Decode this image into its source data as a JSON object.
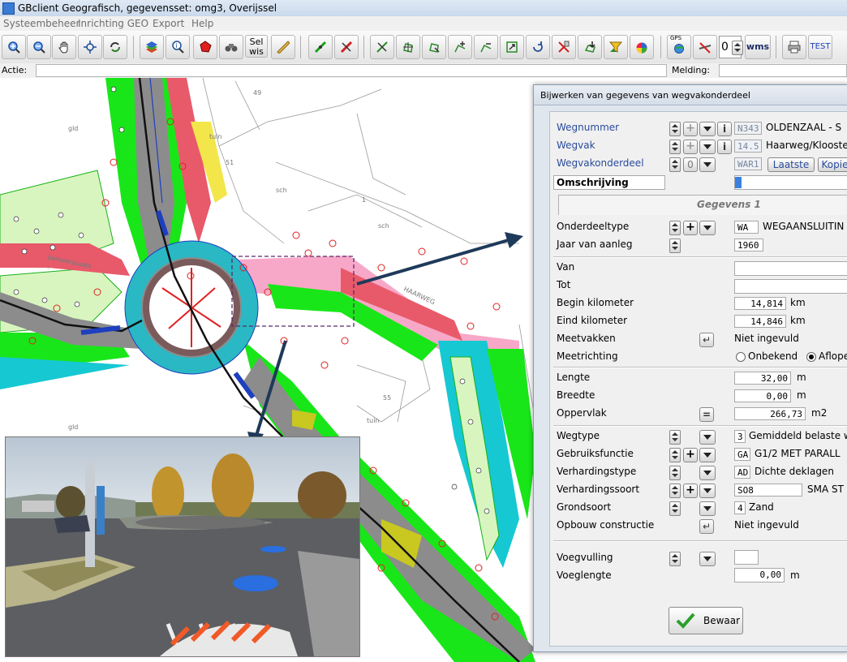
{
  "window": {
    "title": "GBclient Geografisch, gegevensset: omg3, Overijssel"
  },
  "menu": [
    "Systeembeheer",
    "Inrichting GEO",
    "Export",
    "Help"
  ],
  "toolbar": {
    "select_label": "Sel wis",
    "gps_label": "GPS",
    "counter_value": "0",
    "wms_label": "wms",
    "test_label": "TEST"
  },
  "actiebar": {
    "actie_label": "Actie:",
    "actie_value": "",
    "melding_label": "Melding:",
    "melding_value": ""
  },
  "map_labels": {
    "l49": "49",
    "tuin1": "tuin",
    "l51": "51",
    "sch1": "sch",
    "l1": "1",
    "sch2": "sch",
    "l55": "55",
    "tuin2": "tuin",
    "haarweg": "HAARWEG",
    "gld1": "gld",
    "gld2": "gld",
    "parkeerplaats": "parkeerplaats"
  },
  "dialog": {
    "title": "Bijwerken van gegevens van wegvakonderdeel",
    "wegnummer": {
      "label": "Wegnummer",
      "code": "N343",
      "name": "OLDENZAAL - S"
    },
    "wegvak": {
      "label": "Wegvak",
      "code": "14.5",
      "name": "Haarweg/Klooste"
    },
    "wegvakonderdeel": {
      "label": "Wegvakonderdeel",
      "code": "WAR1",
      "counter": "0",
      "laatste": "Laatste",
      "kopie": "Kopie"
    },
    "omschrijving": {
      "label": "Omschrijving",
      "value": ""
    },
    "tab": "Gegevens 1",
    "onderdeeltype": {
      "label": "Onderdeeltype",
      "code": "WA",
      "name": "WEGAANSLUITIN"
    },
    "jaar": {
      "label": "Jaar van aanleg",
      "value": "1960"
    },
    "van": {
      "label": "Van",
      "value": ""
    },
    "tot": {
      "label": "Tot",
      "value": ""
    },
    "begin_km": {
      "label": "Begin kilometer",
      "value": "14,814",
      "unit": "km"
    },
    "eind_km": {
      "label": "Eind kilometer",
      "value": "14,846",
      "unit": "km"
    },
    "meetvakken": {
      "label": "Meetvakken",
      "value": "Niet ingevuld"
    },
    "meetrichting": {
      "label": "Meetrichting",
      "option1": "Onbekend",
      "option2": "Aflope",
      "selected": "Aflope"
    },
    "lengte": {
      "label": "Lengte",
      "value": "32,00",
      "unit": "m"
    },
    "breedte": {
      "label": "Breedte",
      "value": "0,00",
      "unit": "m"
    },
    "oppervlak": {
      "label": "Oppervlak",
      "eq": "=",
      "value": "266,73",
      "unit": "m2"
    },
    "wegtype": {
      "label": "Wegtype",
      "code": "3",
      "name": "Gemiddeld belaste w"
    },
    "gebruiksfunctie": {
      "label": "Gebruiksfunctie",
      "code": "GA",
      "name": "G1/2 MET PARALL"
    },
    "verhardingstype": {
      "label": "Verhardingstype",
      "code": "AD",
      "name": "Dichte deklagen"
    },
    "verhardingssoort": {
      "label": "Verhardingssoort",
      "code": "SO8",
      "name": "SMA ST"
    },
    "grondsoort": {
      "label": "Grondsoort",
      "code": "4",
      "name": "Zand"
    },
    "opbouw": {
      "label": "Opbouw constructie",
      "value": "Niet ingevuld"
    },
    "voegvulling": {
      "label": "Voegvulling",
      "value": ""
    },
    "voeglengte": {
      "label": "Voeglengte",
      "value": "0,00",
      "unit": "m"
    },
    "bewaar": "Bewaar"
  },
  "colors": {
    "green": "#19e619",
    "pink": "#f07ab4",
    "red": "#e85a6a",
    "cyan": "#16c8d2",
    "gray": "#8c8c8c",
    "dialog_blue": "#2a4b9c"
  }
}
